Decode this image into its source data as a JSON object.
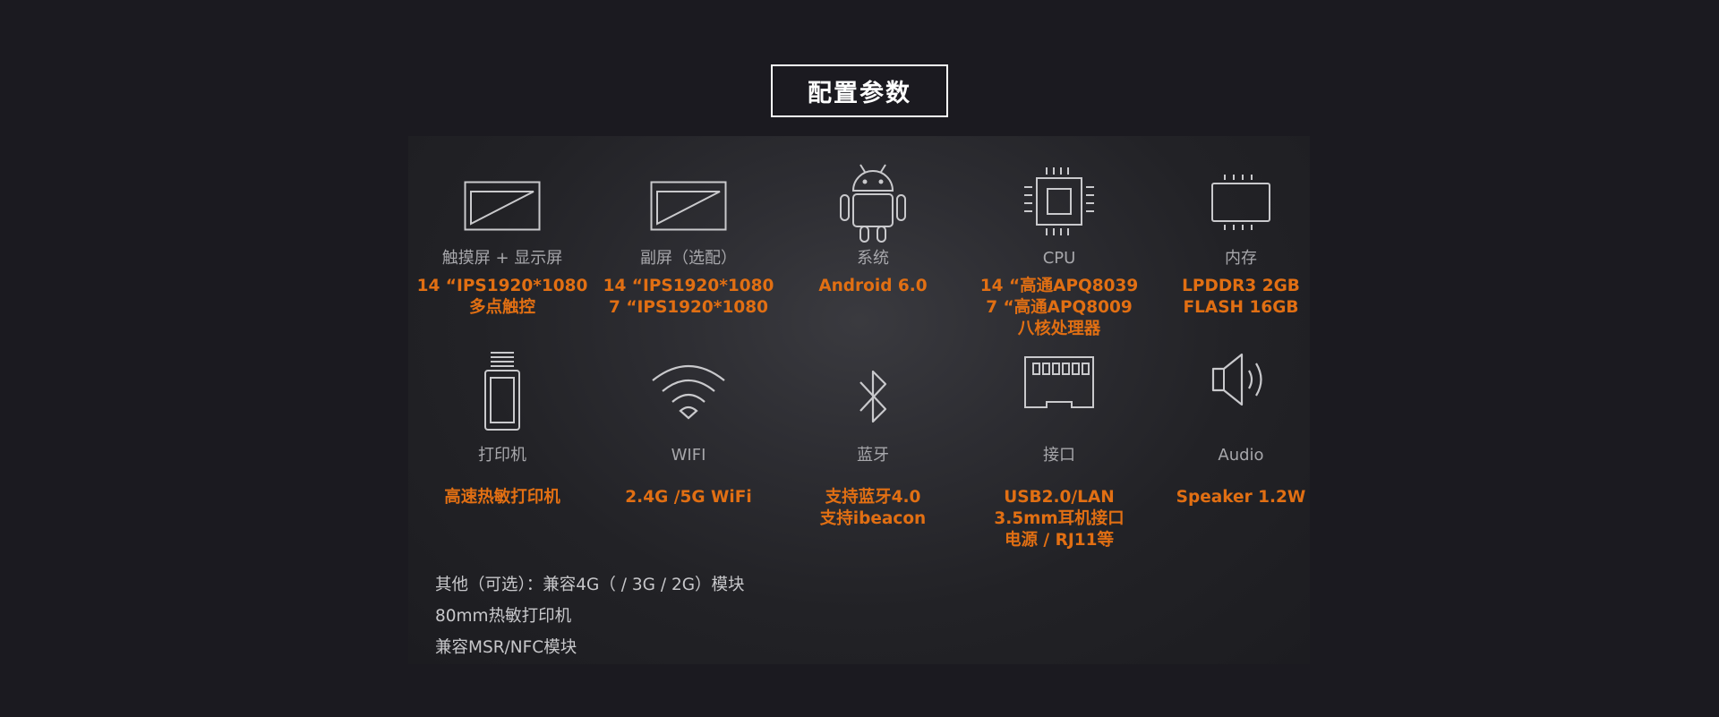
{
  "header": {
    "title": "配置参数"
  },
  "specs": [
    {
      "icon": "touchscreen-icon",
      "label": "触摸屏 + 显示屏",
      "values": [
        "14 “IPS1920*1080",
        "多点触控"
      ]
    },
    {
      "icon": "sub-screen-icon",
      "label": "副屏（选配）",
      "values": [
        "14 “IPS1920*1080",
        "7 “IPS1920*1080"
      ]
    },
    {
      "icon": "android-icon",
      "label": "系统",
      "values": [
        "Android 6.0"
      ]
    },
    {
      "icon": "cpu-icon",
      "label": "CPU",
      "values": [
        "14 “高通APQ8039",
        "7 “高通APQ8009",
        "八核处理器"
      ]
    },
    {
      "icon": "memory-icon",
      "label": "内存",
      "values": [
        "LPDDR3  2GB",
        "FLASH 16GB"
      ]
    },
    {
      "icon": "printer-icon",
      "label": "打印机",
      "values": [
        "高速热敏打印机"
      ]
    },
    {
      "icon": "wifi-icon",
      "label": "WIFI",
      "values": [
        "2.4G /5G WiFi"
      ]
    },
    {
      "icon": "bluetooth-icon",
      "label": "蓝牙",
      "values": [
        "支持蓝牙4.0",
        "支持ibeacon"
      ]
    },
    {
      "icon": "interface-port-icon",
      "label": "接口",
      "values": [
        "USB2.0/LAN",
        "3.5mm耳机接口",
        "电源 / RJ11等"
      ]
    },
    {
      "icon": "speaker-icon",
      "label": "Audio",
      "values": [
        "Speaker 1.2W"
      ]
    }
  ],
  "extras": [
    "其他（可选）：兼容4G（ / 3G / 2G）模块",
    "80mm热敏打印机",
    "兼容MSR/NFC模块"
  ],
  "colors": {
    "background": "#1b1a20",
    "accent": "#e16f13",
    "label": "#a7a7ab",
    "icon_stroke": "#c9c9cc"
  }
}
